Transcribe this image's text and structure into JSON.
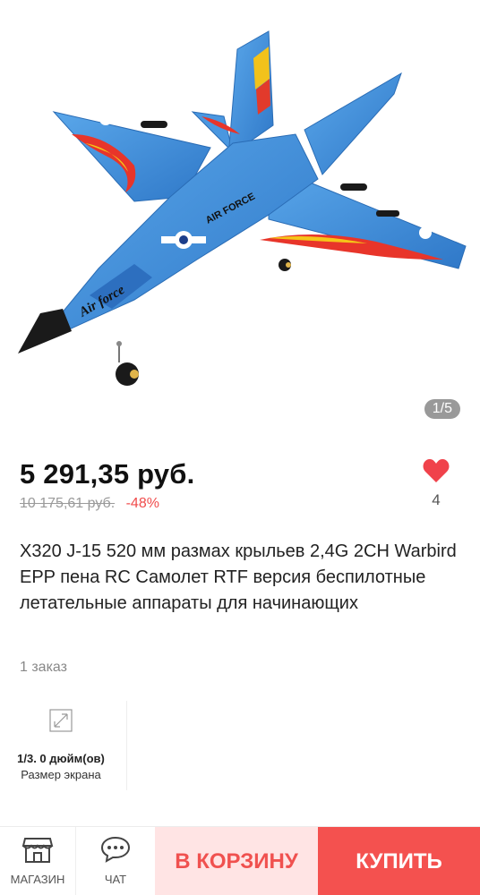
{
  "gallery": {
    "counter": "1/5",
    "decal_text_1": "Air force",
    "decal_text_2": "AIR FORCE"
  },
  "product": {
    "price": "5 291,35 руб.",
    "old_price": "10 175,61 руб.",
    "discount": "-48%",
    "wishlist_count": "4",
    "title": "X320 J-15 520 мм размах крыльев 2,4G 2CH Warbird EPP пена RC Самолет RTF версия беспилотные летательные аппараты для начинающих",
    "orders": "1 заказ"
  },
  "specs": [
    {
      "value": "1/3. 0 дюйм(ов)",
      "label": "Размер экрана",
      "icon": "screen-size-icon"
    }
  ],
  "bottom_bar": {
    "store_label": "МАГАЗИН",
    "chat_label": "ЧАТ",
    "cart_label": "В КОРЗИНУ",
    "buy_label": "КУПИТЬ"
  },
  "colors": {
    "accent": "#f4514f",
    "cart_bg": "#ffe4e4",
    "heart": "#f0424b",
    "plane_blue": "#3f8ed8"
  },
  "icons": [
    "heart-icon",
    "screen-size-icon",
    "store-icon",
    "chat-icon"
  ]
}
